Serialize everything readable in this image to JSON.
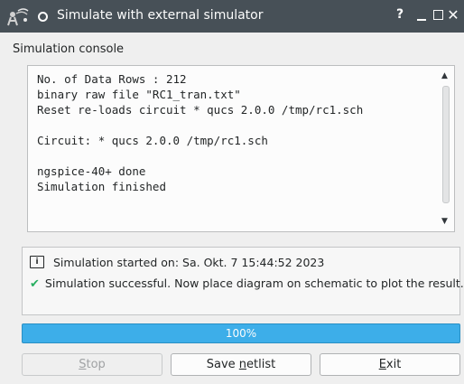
{
  "window": {
    "title": "Simulate with external simulator",
    "help_label": "?",
    "close_label": "✕"
  },
  "console": {
    "label": "Simulation console",
    "text": "No. of Data Rows : 212\nbinary raw file \"RC1_tran.txt\"\nReset re-loads circuit * qucs 2.0.0 /tmp/rc1.sch\n\nCircuit: * qucs 2.0.0 /tmp/rc1.sch\n\nngspice-40+ done\nSimulation finished",
    "scroll_up_glyph": "▲",
    "scroll_down_glyph": "▼"
  },
  "status": {
    "started": "Simulation started on: Sa. Okt. 7 15:44:52 2023",
    "result": "Simulation successful. Now place diagram on schematic to plot the result.",
    "info_glyph": "i",
    "check_glyph": "✔"
  },
  "progress": {
    "value": 100,
    "label": "100%"
  },
  "buttons": {
    "stop": {
      "pre": "",
      "mnemonic": "S",
      "post": "top",
      "enabled": false
    },
    "save_netlist": {
      "pre": "Save ",
      "mnemonic": "n",
      "post": "etlist",
      "enabled": true
    },
    "exit": {
      "pre": "",
      "mnemonic": "E",
      "post": "xit",
      "enabled": true
    }
  },
  "colors": {
    "titlebar": "#475057",
    "progress": "#3daee9",
    "success": "#27ae60"
  }
}
